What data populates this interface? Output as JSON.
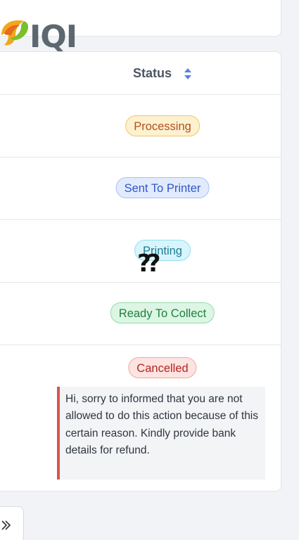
{
  "header": {
    "logo_text": "IQI"
  },
  "table": {
    "column_header": "Status",
    "rows": [
      {
        "status": "Processing"
      },
      {
        "status": "Sent To Printer"
      },
      {
        "status": "Printing"
      },
      {
        "status": "Ready To Collect"
      },
      {
        "status": "Cancelled",
        "note": "Hi, sorry to informed that you are not allowed to do this action because of this certain reason. Kindly provide bank details for refund."
      }
    ]
  },
  "overlay": {
    "glyph": "??"
  },
  "pagination": {
    "last_page_icon": "double-chevron-right-icon"
  },
  "colors": {
    "processing": "#b0521f",
    "sent_to_printer": "#2f55c9",
    "printing": "#1a7d92",
    "ready_to_collect": "#21803f",
    "cancelled": "#b3261e",
    "sort_icon": "#5b7ee5"
  }
}
